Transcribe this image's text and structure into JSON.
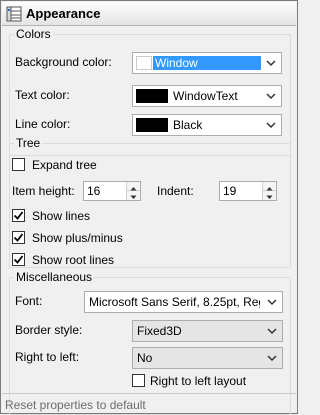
{
  "window": {
    "title": "Appearance"
  },
  "colors": {
    "group_title": "Colors",
    "background_label": "Background color:",
    "background_value": "Window",
    "text_label": "Text color:",
    "text_value": "WindowText",
    "text_swatch": "#000000",
    "line_label": "Line color:",
    "line_value": "Black",
    "line_swatch": "#000000"
  },
  "tree": {
    "group_title": "Tree",
    "expand_tree": {
      "label": "Expand tree",
      "checked": false
    },
    "item_height_label": "Item height:",
    "item_height_value": "16",
    "indent_label": "Indent:",
    "indent_value": "19",
    "show_lines": {
      "label": "Show lines",
      "checked": true
    },
    "show_plus_minus": {
      "label": "Show plus/minus",
      "checked": true
    },
    "show_root_lines": {
      "label": "Show root lines",
      "checked": true
    }
  },
  "misc": {
    "group_title": "Miscellaneous",
    "font_label": "Font:",
    "font_value": "Microsoft Sans Serif, 8.25pt, Regu",
    "border_label": "Border style:",
    "border_value": "Fixed3D",
    "rtl_label": "Right to left:",
    "rtl_value": "No",
    "rtl_layout": {
      "label": "Right to left layout",
      "checked": false
    }
  },
  "footer": {
    "reset_label": "Reset properties to default"
  },
  "accent": {
    "selection": "#3399ff"
  }
}
